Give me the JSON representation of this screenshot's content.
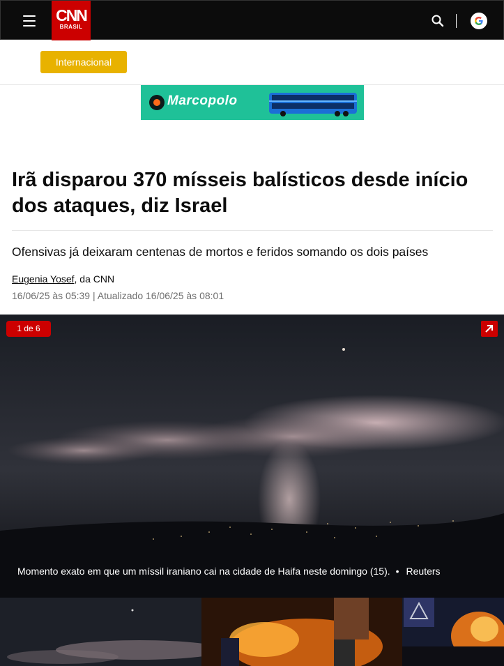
{
  "header": {
    "logo_text": "CNN",
    "logo_sub": "BRASIL",
    "menu_icon": "hamburger-menu-icon",
    "search_icon": "search-icon",
    "google_icon": "google-icon"
  },
  "section": {
    "label": "Internacional",
    "color": "#e8b200"
  },
  "ad": {
    "brand": "Marcopolo",
    "color": "#1fc198"
  },
  "article": {
    "headline": "Irã disparou 370 mísseis balísticos desde início dos ataques, diz Israel",
    "subhead": "Ofensivas já deixaram centenas de mortos e feridos somando os dois países",
    "author": "Eugenia Yosef",
    "author_suffix": ", da CNN",
    "timestamp": "16/06/25 às 05:39 | Atualizado 16/06/25 às 08:01"
  },
  "gallery": {
    "counter": "1 de 6",
    "caption": "Momento exato em que um míssil iraniano cai na cidade de Haifa neste domingo (15).",
    "bullet": "•",
    "credit": "Reuters",
    "accent": "#cc0000"
  }
}
